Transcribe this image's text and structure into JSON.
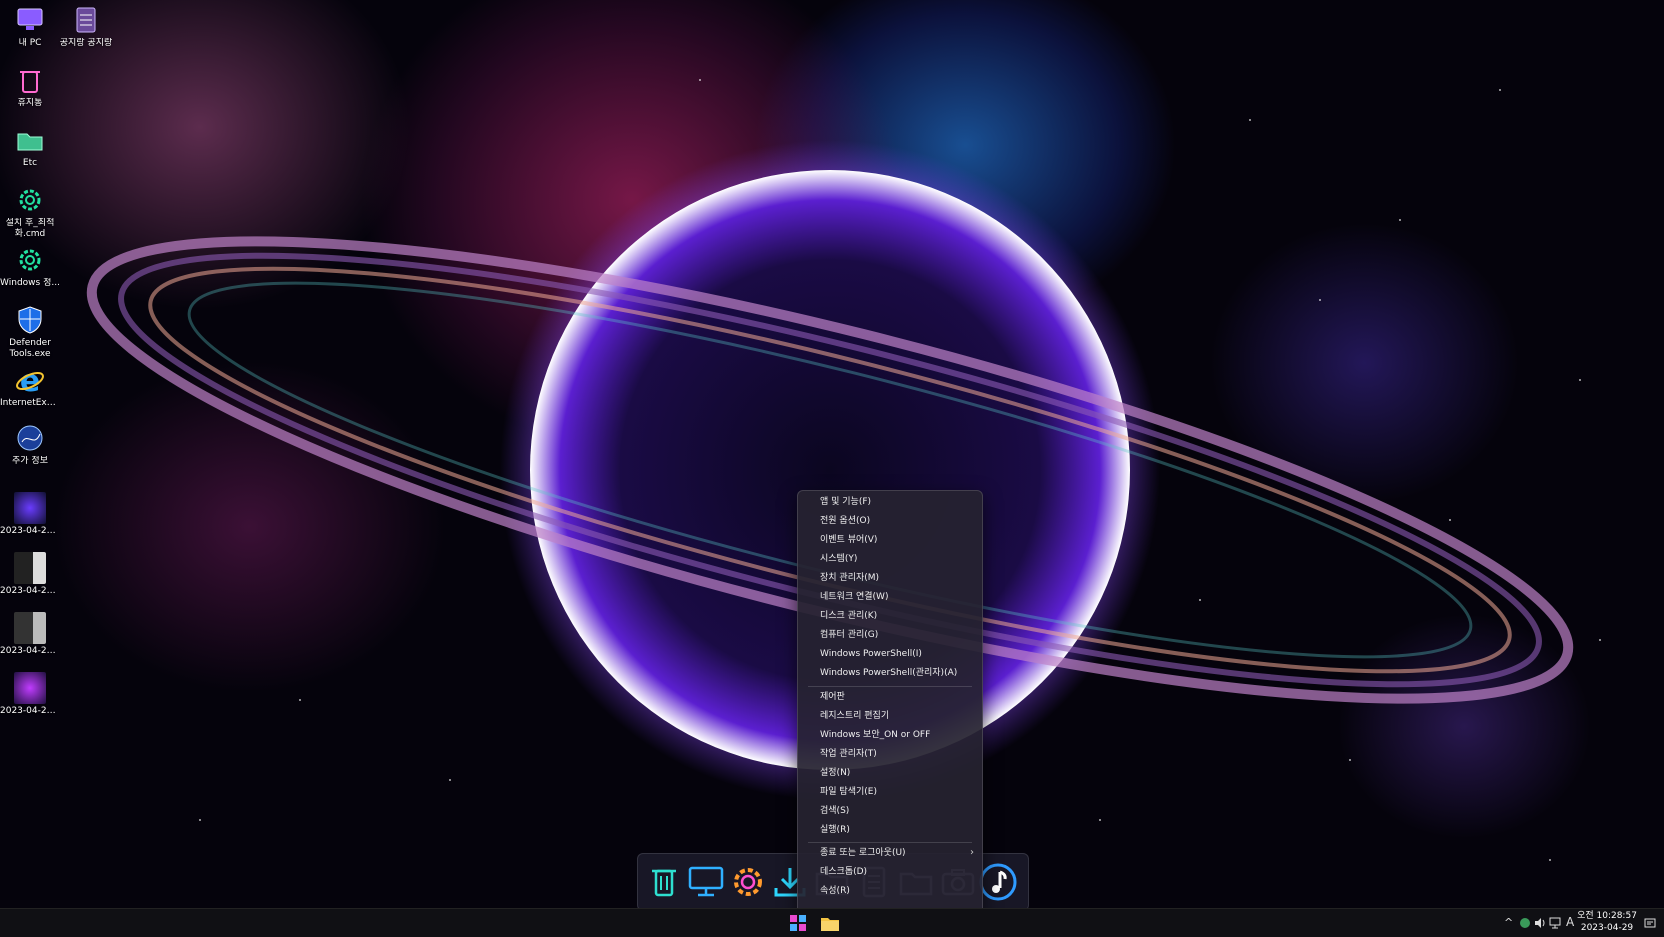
{
  "desktop": {
    "icons": [
      {
        "label": "내 PC",
        "icon": "monitor-icon"
      },
      {
        "label": "공지랑 공지랑",
        "icon": "notepad-icon"
      },
      {
        "label": "휴지통",
        "icon": "recycle-bin-icon"
      },
      {
        "label": "Etc",
        "icon": "folder-icon"
      },
      {
        "label": "설치 후_최적화.cmd",
        "icon": "gear-icon"
      },
      {
        "label": "Windows 정...",
        "icon": "gear-icon"
      },
      {
        "label": "Defender Tools.exe",
        "icon": "shield-icon"
      },
      {
        "label": "InternetExpl...",
        "icon": "internet-explorer-icon"
      },
      {
        "label": "추가 정보",
        "icon": "globe-icon"
      },
      {
        "label": "2023-04-29_...",
        "icon": "screenshot-thumbnail-icon"
      },
      {
        "label": "2023-04-29_...",
        "icon": "screenshot-thumbnail-icon"
      },
      {
        "label": "2023-04-29_...",
        "icon": "screenshot-thumbnail-icon"
      },
      {
        "label": "2023-04-29_...",
        "icon": "screenshot-thumbnail-icon"
      }
    ]
  },
  "context_menu": {
    "group1": [
      "앱 및 기능(F)",
      "전원 옵션(O)",
      "이벤트 뷰어(V)",
      "시스템(Y)",
      "장치 관리자(M)",
      "네트워크 연결(W)",
      "디스크 관리(K)",
      "컴퓨터 관리(G)",
      "Windows PowerShell(I)",
      "Windows PowerShell(관리자)(A)"
    ],
    "group2": [
      "제어판",
      "레지스트리 편집기",
      "Windows 보안_ON or OFF",
      "작업 관리자(T)",
      "설정(N)",
      "파일 탐색기(E)",
      "검색(S)",
      "실행(R)"
    ],
    "group3": [
      "종료 또는 로그아웃(U)",
      "데스크톱(D)",
      "속성(R)"
    ],
    "submenu_arrow": "›"
  },
  "dock": {
    "icons": [
      "recycle-bin-icon",
      "monitor-icon",
      "gear-icon",
      "download-icon",
      "folder-icon",
      "document-icon",
      "folder-icon",
      "camera-icon",
      "music-icon"
    ]
  },
  "taskbar": {
    "buttons": [
      "start-button",
      "file-explorer-button"
    ],
    "tray": {
      "chevron": "^",
      "ime": "A"
    },
    "clock": {
      "time": "오전 10:28:57",
      "date": "2023-04-29"
    }
  }
}
